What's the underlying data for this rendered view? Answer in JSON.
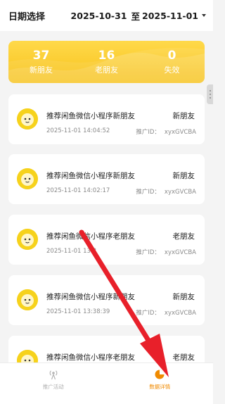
{
  "header": {
    "title": "日期选择",
    "start_date": "2025-10-31",
    "separator": "至",
    "end_date": "2025-11-01"
  },
  "stats": [
    {
      "value": "37",
      "label": "新朋友"
    },
    {
      "value": "16",
      "label": "老朋友"
    },
    {
      "value": "0",
      "label": "失效"
    }
  ],
  "records": [
    {
      "title": "推荐闲鱼微信小程序新朋友",
      "status": "新朋友",
      "time": "2025-11-01 14:04:52",
      "promo_label": "推广ID：",
      "promo_id": "xyxGVCBA"
    },
    {
      "title": "推荐闲鱼微信小程序新朋友",
      "status": "新朋友",
      "time": "2025-11-01 14:02:17",
      "promo_label": "推广ID：",
      "promo_id": "xyxGVCBA"
    },
    {
      "title": "推荐闲鱼微信小程序老朋友",
      "status": "老朋友",
      "time": "2025-11-01 13:3",
      "promo_label": "推广ID：",
      "promo_id": "xyxGVCBA"
    },
    {
      "title": "推荐闲鱼微信小程序新朋友",
      "status": "新朋友",
      "time": "2025-11-01 13:38:39",
      "promo_label": "推广ID：",
      "promo_id": "xyxGVCBA"
    },
    {
      "title": "推荐闲鱼微信小程序老朋友",
      "status": "老朋友",
      "time": "",
      "promo_label": "",
      "promo_id": ""
    }
  ],
  "tabbar": {
    "tab1_label": "推广活动",
    "tab2_label": "数据详情"
  },
  "colors": {
    "accent": "#f7c21b",
    "active_tab": "#f08a00",
    "annotation_arrow": "#e8202a"
  },
  "icons": {
    "tab1": "broadcast-icon",
    "tab2": "pie-chart-icon",
    "avatar": "mascot-avatar-icon"
  }
}
